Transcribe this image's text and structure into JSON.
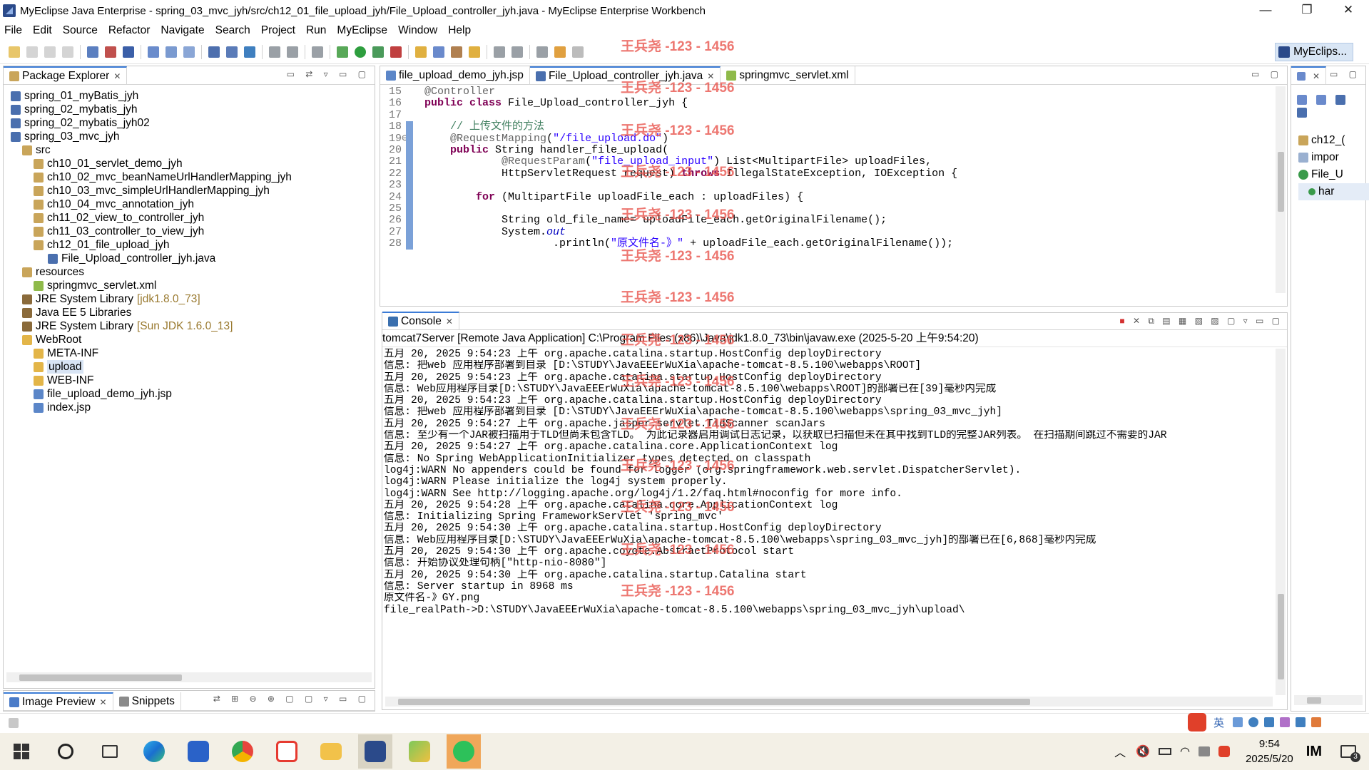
{
  "window": {
    "title": "MyEclipse Java Enterprise - spring_03_mvc_jyh/src/ch12_01_file_upload_jyh/File_Upload_controller_jyh.java - MyEclipse Enterprise Workbench",
    "minimize": "—",
    "restore": "❐",
    "close": "✕"
  },
  "menu": [
    "File",
    "Edit",
    "Source",
    "Refactor",
    "Navigate",
    "Search",
    "Project",
    "Run",
    "MyEclipse",
    "Window",
    "Help"
  ],
  "perspective": "MyEclips...",
  "explorer": {
    "tab": "Package Explorer",
    "items": [
      {
        "label": "spring_01_myBatis_jyh",
        "indent": 0,
        "icon": "project-icon"
      },
      {
        "label": "spring_02_mybatis_jyh",
        "indent": 0,
        "icon": "project-icon"
      },
      {
        "label": "spring_02_mybatis_jyh02",
        "indent": 0,
        "icon": "project-icon"
      },
      {
        "label": "spring_03_mvc_jyh",
        "indent": 0,
        "icon": "project-icon"
      },
      {
        "label": "src",
        "indent": 1,
        "icon": "source-folder-icon"
      },
      {
        "label": "ch10_01_servlet_demo_jyh",
        "indent": 2,
        "icon": "package-icon"
      },
      {
        "label": "ch10_02_mvc_beanNameUrlHandlerMapping_jyh",
        "indent": 2,
        "icon": "package-icon"
      },
      {
        "label": "ch10_03_mvc_simpleUrlHandlerMapping_jyh",
        "indent": 2,
        "icon": "package-icon"
      },
      {
        "label": "ch10_04_mvc_annotation_jyh",
        "indent": 2,
        "icon": "package-icon"
      },
      {
        "label": "ch11_02_view_to_controller_jyh",
        "indent": 2,
        "icon": "package-icon"
      },
      {
        "label": "ch11_03_controller_to_view_jyh",
        "indent": 2,
        "icon": "package-icon"
      },
      {
        "label": "ch12_01_file_upload_jyh",
        "indent": 2,
        "icon": "package-icon"
      },
      {
        "label": "File_Upload_controller_jyh.java",
        "indent": 3,
        "icon": "java-file-icon"
      },
      {
        "label": "resources",
        "indent": 1,
        "icon": "source-folder-icon"
      },
      {
        "label": "springmvc_servlet.xml",
        "indent": 2,
        "icon": "xml-file-icon"
      },
      {
        "label": "JRE System Library",
        "suffix": "[jdk1.8.0_73]",
        "indent": 1,
        "icon": "library-icon"
      },
      {
        "label": "Java EE 5 Libraries",
        "indent": 1,
        "icon": "library-icon"
      },
      {
        "label": "JRE System Library",
        "suffix": "[Sun JDK 1.6.0_13]",
        "indent": 1,
        "icon": "library-icon"
      },
      {
        "label": "WebRoot",
        "indent": 1,
        "icon": "folder-icon"
      },
      {
        "label": "META-INF",
        "indent": 2,
        "icon": "folder-icon"
      },
      {
        "label": "upload",
        "indent": 2,
        "icon": "folder-icon",
        "selected": true
      },
      {
        "label": "WEB-INF",
        "indent": 2,
        "icon": "folder-icon"
      },
      {
        "label": "file_upload_demo_jyh.jsp",
        "indent": 2,
        "icon": "jsp-file-icon"
      },
      {
        "label": "index.jsp",
        "indent": 2,
        "icon": "jsp-file-icon"
      }
    ]
  },
  "bottomleft": {
    "tab1": "Image Preview",
    "tab2": "Snippets"
  },
  "editor": {
    "tabs": [
      {
        "label": "file_upload_demo_jyh.jsp"
      },
      {
        "label": "File_Upload_controller_jyh.java",
        "active": true
      },
      {
        "label": "springmvc_servlet.xml"
      }
    ],
    "lines": [
      {
        "n": "15",
        "html": "<span class=\"an\">@Controller</span>"
      },
      {
        "n": "16",
        "html": "<span class=\"kw\">public class</span> File_Upload_controller_jyh {"
      },
      {
        "n": "17",
        "html": ""
      },
      {
        "n": "18",
        "html": "    <span class=\"cm\">// 上传文件的方法</span>"
      },
      {
        "n": "19⊖",
        "html": "    <span class=\"an\">@RequestMapping</span>(<span class=\"st\">\"/file_upload.do\"</span>)"
      },
      {
        "n": "20",
        "html": "    <span class=\"kw\">public</span> String handler_file_upload("
      },
      {
        "n": "21",
        "html": "            <span class=\"an\">@RequestParam</span>(<span class=\"st\">\"file_upload_input\"</span>) List&lt;MultipartFile&gt; uploadFiles,"
      },
      {
        "n": "22",
        "html": "            HttpServletRequest request) <span class=\"kw\">throws</span> IllegalStateException, IOException {"
      },
      {
        "n": "23",
        "html": ""
      },
      {
        "n": "24",
        "html": "        <span class=\"kw\">for</span> (MultipartFile uploadFile_each : uploadFiles) {"
      },
      {
        "n": "25",
        "html": ""
      },
      {
        "n": "26",
        "html": "            String old_file_name= uploadFile_each.getOriginalFilename();"
      },
      {
        "n": "27",
        "html": "            System.<span class=\"fld\">out</span>"
      },
      {
        "n": "28",
        "html": "                    .println(<span class=\"st\">\"原文件名-》\"</span> + uploadFile_each.getOriginalFilename());"
      }
    ]
  },
  "outline": {
    "items": [
      "ch12_(",
      "impor",
      "File_U",
      "har"
    ]
  },
  "console": {
    "tab": "Console",
    "header": "tomcat7Server [Remote Java Application] C:\\Program Files (x86)\\Java\\jdk1.8.0_73\\bin\\javaw.exe (2025-5-20 上午9:54:20)",
    "lines": [
      "五月 20, 2025 9:54:23 上午 org.apache.catalina.startup.HostConfig deployDirectory",
      "信息: 把web 应用程序部署到目录 [D:\\STUDY\\JavaEEErWuXia\\apache-tomcat-8.5.100\\webapps\\ROOT]",
      "五月 20, 2025 9:54:23 上午 org.apache.catalina.startup.HostConfig deployDirectory",
      "信息: Web应用程序目录[D:\\STUDY\\JavaEEErWuXia\\apache-tomcat-8.5.100\\webapps\\ROOT]的部署已在[39]毫秒内完成",
      "五月 20, 2025 9:54:23 上午 org.apache.catalina.startup.HostConfig deployDirectory",
      "信息: 把web 应用程序部署到目录 [D:\\STUDY\\JavaEEErWuXia\\apache-tomcat-8.5.100\\webapps\\spring_03_mvc_jyh]",
      "五月 20, 2025 9:54:27 上午 org.apache.jasper.servlet.TldScanner scanJars",
      "信息: 至少有一个JAR被扫描用于TLD但尚未包含TLD。 为此记录器启用调试日志记录，以获取已扫描但未在其中找到TLD的完整JAR列表。 在扫描期间跳过不需要的JAR",
      "五月 20, 2025 9:54:27 上午 org.apache.catalina.core.ApplicationContext log",
      "信息: No Spring WebApplicationInitializer types detected on classpath",
      "log4j:WARN No appenders could be found for logger (org.springframework.web.servlet.DispatcherServlet).",
      "log4j:WARN Please initialize the log4j system properly.",
      "log4j:WARN See http://logging.apache.org/log4j/1.2/faq.html#noconfig for more info.",
      "五月 20, 2025 9:54:28 上午 org.apache.catalina.core.ApplicationContext log",
      "信息: Initializing Spring FrameworkServlet 'spring_mvc'",
      "五月 20, 2025 9:54:30 上午 org.apache.catalina.startup.HostConfig deployDirectory",
      "信息: Web应用程序目录[D:\\STUDY\\JavaEEErWuXia\\apache-tomcat-8.5.100\\webapps\\spring_03_mvc_jyh]的部署已在[6,868]毫秒内完成",
      "五月 20, 2025 9:54:30 上午 org.apache.coyote.AbstractProtocol start",
      "信息: 开始协议处理句柄[\"http-nio-8080\"]",
      "五月 20, 2025 9:54:30 上午 org.apache.catalina.startup.Catalina start",
      "信息: Server startup in 8968 ms",
      "原文件名-》GY.png",
      "file_realPath->D:\\STUDY\\JavaEEErWuXia\\apache-tomcat-8.5.100\\webapps\\spring_03_mvc_jyh\\upload\\"
    ]
  },
  "watermark": "王兵尧 -123 - 1456",
  "ime": {
    "label": "英"
  },
  "clock": {
    "time": "9:54",
    "date": "2025/5/20"
  },
  "notification_count": "3"
}
